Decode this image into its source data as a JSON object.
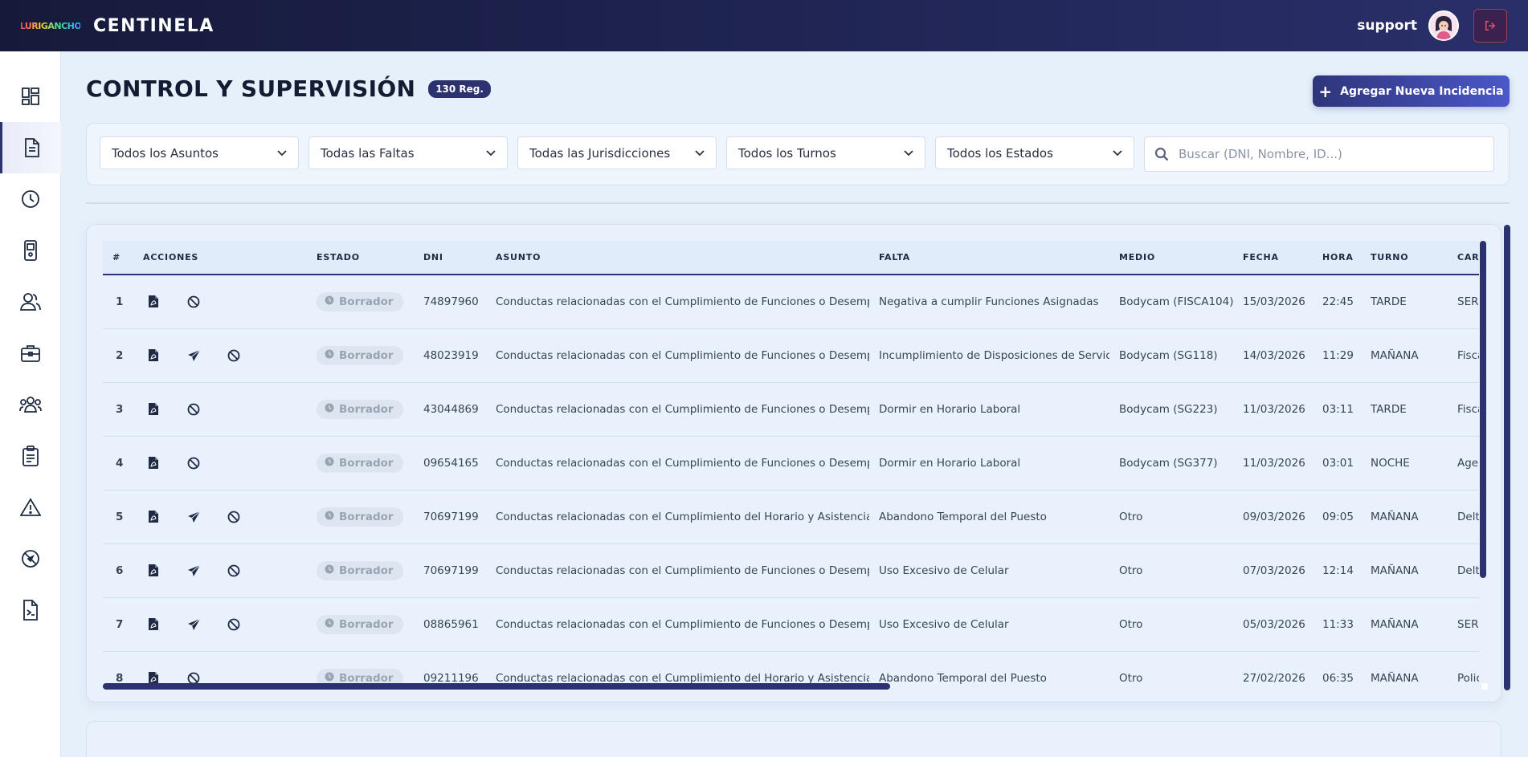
{
  "header": {
    "logo_text": "LURIGANCHO",
    "app_title": "CENTINELA",
    "username": "support"
  },
  "sidebar": {
    "items": [
      {
        "name": "dashboard",
        "icon": "dashboard-icon"
      },
      {
        "name": "documents",
        "icon": "document-icon",
        "active": true
      },
      {
        "name": "history",
        "icon": "clock-icon"
      },
      {
        "name": "devices",
        "icon": "device-icon"
      },
      {
        "name": "users",
        "icon": "users-icon"
      },
      {
        "name": "briefcase",
        "icon": "briefcase-icon"
      },
      {
        "name": "groups",
        "icon": "group-icon"
      },
      {
        "name": "checklist",
        "icon": "clipboard-icon"
      },
      {
        "name": "alerts",
        "icon": "warning-icon"
      },
      {
        "name": "blocked",
        "icon": "block-icon"
      },
      {
        "name": "reports",
        "icon": "report-icon"
      }
    ]
  },
  "page": {
    "title": "CONTROL Y SUPERVISIÓN",
    "reg_count": "130 Reg.",
    "add_button": "Agregar Nueva Incidencia"
  },
  "filters": {
    "asuntos": "Todos los Asuntos",
    "faltas": "Todas las Faltas",
    "jurisdicciones": "Todas las Jurisdicciones",
    "turnos": "Todos los Turnos",
    "estados": "Todos los Estados",
    "search_placeholder": "Buscar (DNI, Nombre, ID...)"
  },
  "table": {
    "columns": [
      "#",
      "ACCIONES",
      "ESTADO",
      "DNI",
      "ASUNTO",
      "FALTA",
      "MEDIO",
      "FECHA",
      "HORA",
      "TURNO",
      "CARGO"
    ],
    "rows": [
      {
        "n": "1",
        "send": false,
        "estado": "Borrador",
        "dni": "74897960",
        "asunto": "Conductas relacionadas con el Cumplimiento de Funciones o Desempeño",
        "falta": "Negativa a cumplir Funciones Asignadas",
        "medio": "Bodycam (FISCA104)",
        "fecha": "15/03/2026",
        "hora": "22:45",
        "turno": "TARDE",
        "cargo": "SERENO"
      },
      {
        "n": "2",
        "send": true,
        "estado": "Borrador",
        "dni": "48023919",
        "asunto": "Conductas relacionadas con el Cumplimiento de Funciones o Desempeño",
        "falta": "Incumplimiento de Disposiciones de Servicio",
        "medio": "Bodycam (SG118)",
        "fecha": "14/03/2026",
        "hora": "11:29",
        "turno": "MAÑANA",
        "cargo": "Fiscalizador"
      },
      {
        "n": "3",
        "send": false,
        "estado": "Borrador",
        "dni": "43044869",
        "asunto": "Conductas relacionadas con el Cumplimiento de Funciones o Desempeño",
        "falta": "Dormir en Horario Laboral",
        "medio": "Bodycam (SG223)",
        "fecha": "11/03/2026",
        "hora": "03:11",
        "turno": "TARDE",
        "cargo": "Fiscalizador"
      },
      {
        "n": "4",
        "send": false,
        "estado": "Borrador",
        "dni": "09654165",
        "asunto": "Conductas relacionadas con el Cumplimiento de Funciones o Desempeño",
        "falta": "Dormir en Horario Laboral",
        "medio": "Bodycam (SG377)",
        "fecha": "11/03/2026",
        "hora": "03:01",
        "turno": "NOCHE",
        "cargo": "Agente"
      },
      {
        "n": "5",
        "send": true,
        "estado": "Borrador",
        "dni": "70697199",
        "asunto": "Conductas relacionadas con el Cumplimiento del Horario y Asistencia",
        "falta": "Abandono Temporal del Puesto",
        "medio": "Otro",
        "fecha": "09/03/2026",
        "hora": "09:05",
        "turno": "MAÑANA",
        "cargo": "Delta"
      },
      {
        "n": "6",
        "send": true,
        "estado": "Borrador",
        "dni": "70697199",
        "asunto": "Conductas relacionadas con el Cumplimiento de Funciones o Desempeño",
        "falta": "Uso Excesivo de Celular",
        "medio": "Otro",
        "fecha": "07/03/2026",
        "hora": "12:14",
        "turno": "MAÑANA",
        "cargo": "Delta"
      },
      {
        "n": "7",
        "send": true,
        "estado": "Borrador",
        "dni": "08865961",
        "asunto": "Conductas relacionadas con el Cumplimiento de Funciones o Desempeño",
        "falta": "Uso Excesivo de Celular",
        "medio": "Otro",
        "fecha": "05/03/2026",
        "hora": "11:33",
        "turno": "MAÑANA",
        "cargo": "SERENO"
      },
      {
        "n": "8",
        "send": false,
        "estado": "Borrador",
        "dni": "09211196",
        "asunto": "Conductas relacionadas con el Cumplimiento del Horario y Asistencia",
        "falta": "Abandono Temporal del Puesto",
        "medio": "Otro",
        "fecha": "27/02/2026",
        "hora": "06:35",
        "turno": "MAÑANA",
        "cargo": "Policía"
      }
    ]
  },
  "colors": {
    "primary": "#2c3170",
    "topbar": "#1e2350",
    "background": "#e6f0fb"
  }
}
